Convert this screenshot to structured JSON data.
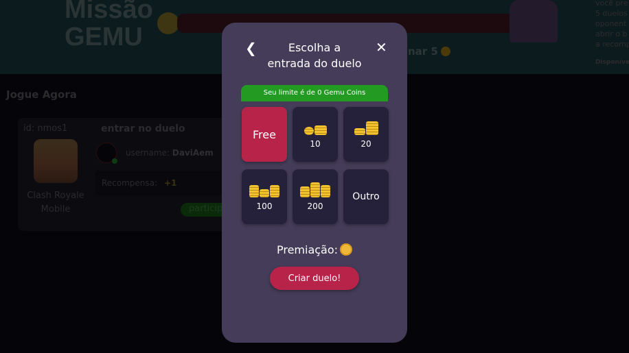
{
  "mission": {
    "title_line1": "Missão",
    "title_line2": "GEMU",
    "goal_text": "nar 5"
  },
  "side_text": {
    "lines": [
      "você pre",
      "5 duelos",
      "oponent",
      "abrir o b",
      "a recomp"
    ],
    "available": "Disponíve"
  },
  "section": {
    "title": "Jogue Agora"
  },
  "duel_card": {
    "id": "id: nmos1",
    "game_name": "Clash Royale Mobile",
    "enter": "entrar no duelo",
    "username_label": "username:",
    "username": "DaviAem",
    "reward_label": "Recompensa:",
    "reward_value": "+1",
    "participate": "particip"
  },
  "modal": {
    "title": "Escolha a entrada do duelo",
    "limit_text": "Seu limite é de 0 Gemu Coins",
    "options": [
      {
        "label": "Free"
      },
      {
        "label": "10",
        "icon": "coins-icon"
      },
      {
        "label": "20",
        "icon": "coins-icon"
      },
      {
        "label": "100",
        "icon": "coins-icon"
      },
      {
        "label": "200",
        "icon": "coins-icon"
      },
      {
        "label": "Outro"
      }
    ],
    "prize_label": "Premiação:",
    "create_button": "Criar duelo!",
    "colors": {
      "accent": "#b8234a",
      "limit_bar": "#239b23",
      "tile": "#26213a",
      "modal": "#443c58"
    }
  }
}
